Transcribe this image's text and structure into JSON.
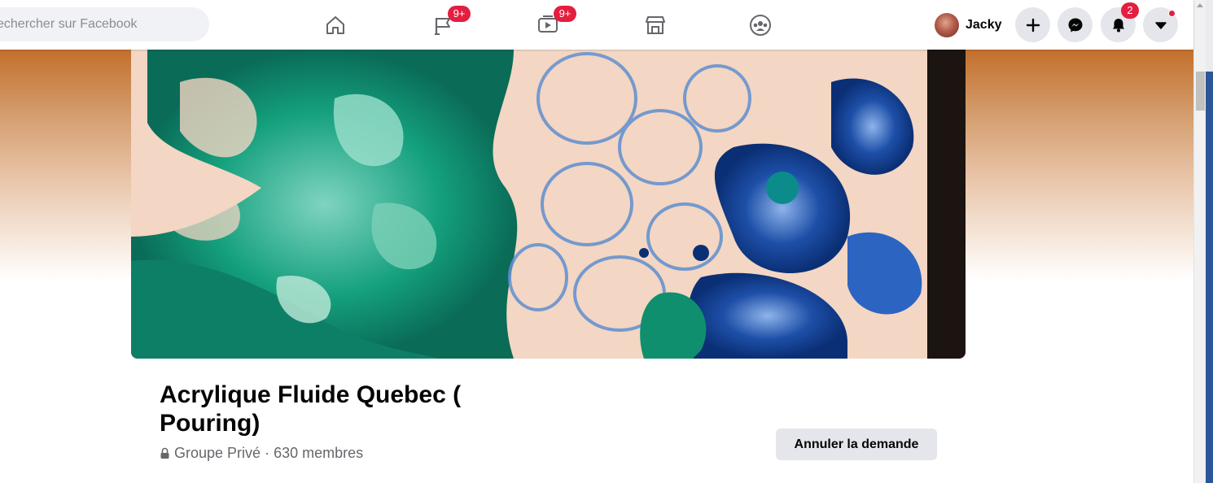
{
  "search": {
    "placeholder": "echercher sur Facebook"
  },
  "nav": {
    "pages_badge": "9+",
    "watch_badge": "9+"
  },
  "profile": {
    "name": "Jacky"
  },
  "notifications": {
    "count": "2"
  },
  "group": {
    "name": "Acrylique Fluide Quebec ( Pouring)",
    "privacy": "Groupe Privé",
    "separator": " · ",
    "members": "630 membres",
    "cancel_request_label": "Annuler la demande"
  },
  "colors": {
    "badge": "#e41e3f",
    "cover_gradient_top": "#c36f2b",
    "cover_teal": "#0f8f6e",
    "cover_blue": "#1d4fa8"
  },
  "icons": [
    "home-icon",
    "flag-icon",
    "watch-icon",
    "marketplace-icon",
    "groups-icon",
    "plus-icon",
    "messenger-icon",
    "bell-icon",
    "caret-down-icon",
    "lock-icon"
  ]
}
